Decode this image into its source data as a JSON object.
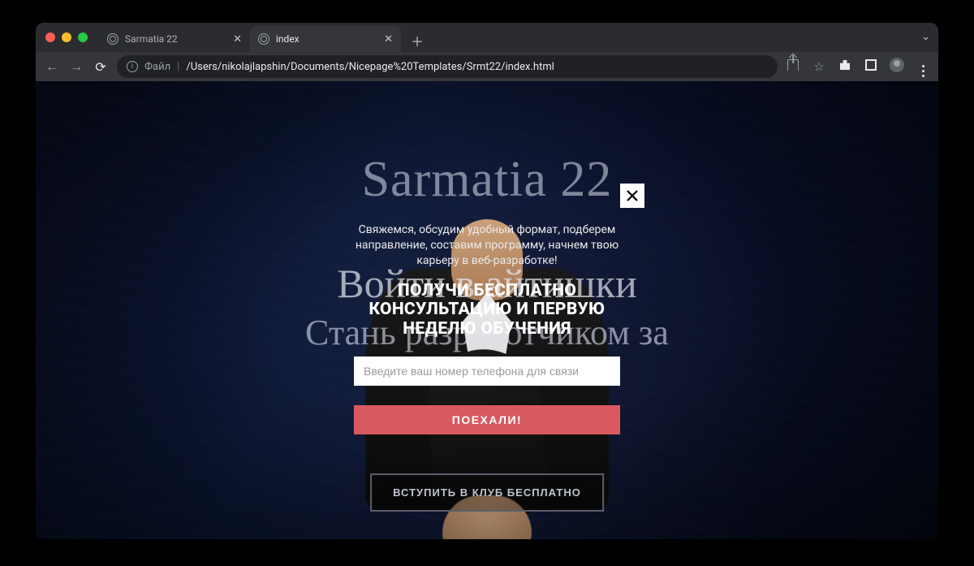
{
  "browser": {
    "tabs": [
      {
        "title": "Sarmatia 22",
        "active": false
      },
      {
        "title": "index",
        "active": true
      }
    ],
    "address": {
      "label": "Файл",
      "path": "/Users/nikolajlapshin/Documents/Nicepage%20Templates/Srmt22/index.html"
    }
  },
  "hero": {
    "brand": "Sarmatia 22",
    "line1": "Войти в айтишки",
    "line2": "Стань разработчиком за",
    "cta": "ВСТУПИТЬ В КЛУБ БЕСПЛАТНО"
  },
  "modal": {
    "desc": "Свяжемся, обсудим удобный формат, подберем направление, составим программу, начнем твою карьеру в веб-разработке!",
    "headline_l1": "ПОЛУЧИ БЕСПЛАТНО",
    "headline_l2": "КОНСУЛЬТАЦИЮ И ПЕРВУЮ",
    "headline_l3": "НЕДЕЛЮ ОБУЧЕНИЯ",
    "placeholder": "Введите ваш номер телефона для связи",
    "submit": "ПОЕХАЛИ!"
  }
}
